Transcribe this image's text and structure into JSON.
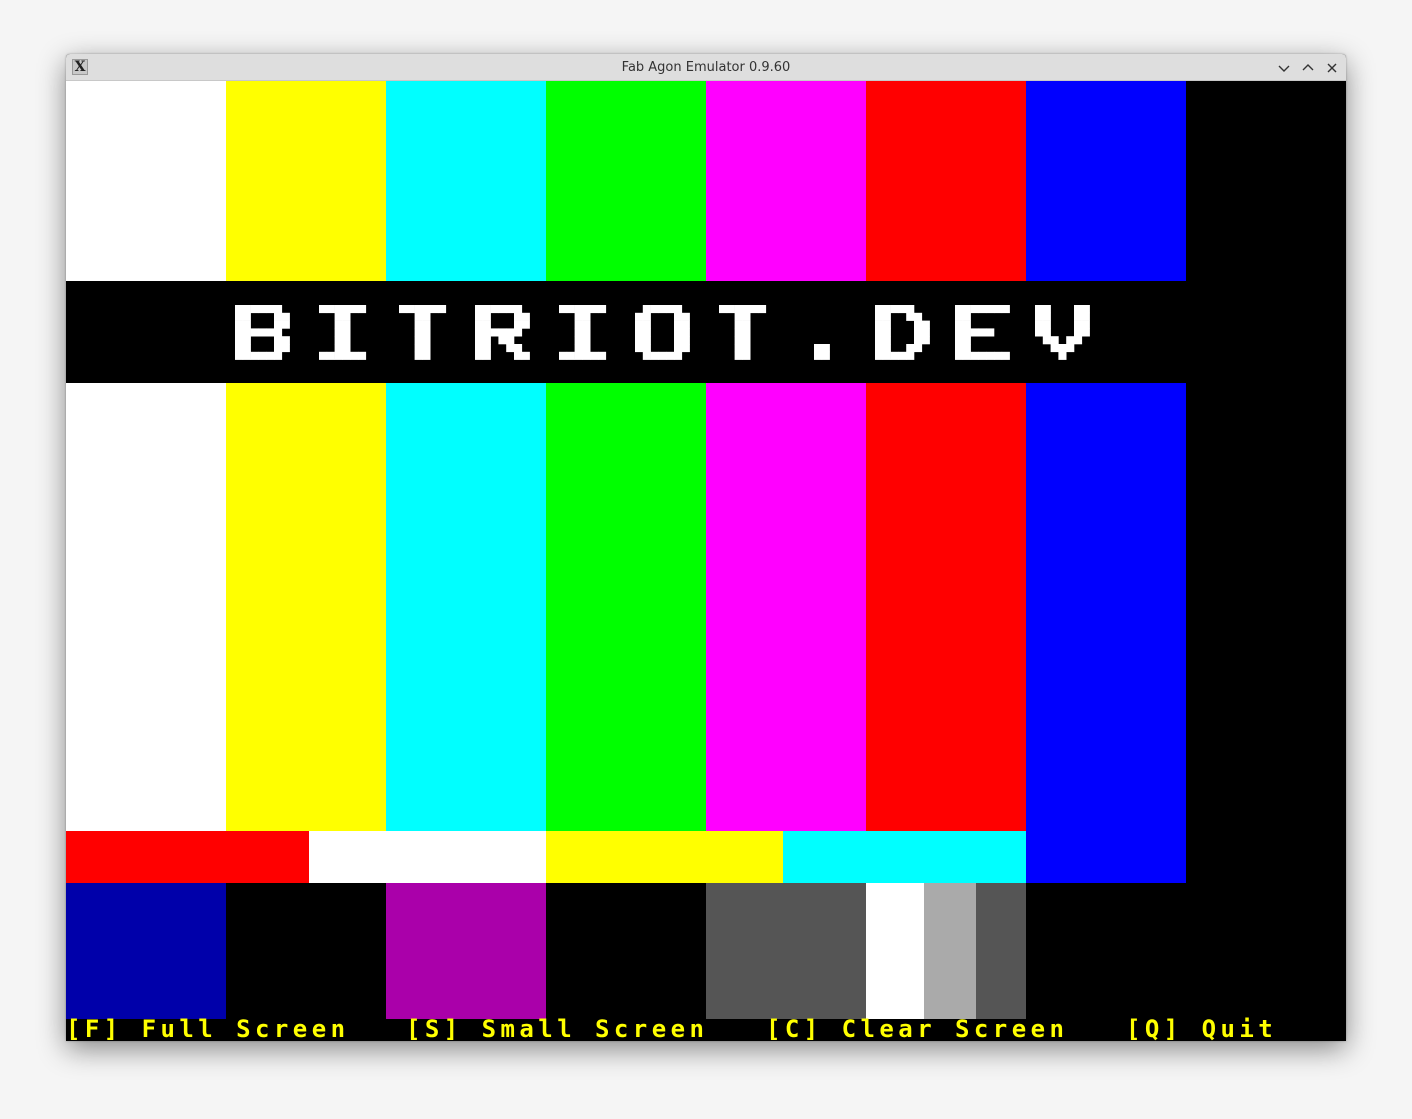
{
  "window": {
    "title": "Fab Agon Emulator 0.9.60",
    "app_icon_glyph": "X",
    "buttons": {
      "minimize_icon": "chevron-down-icon",
      "maximize_icon": "chevron-up-icon",
      "close_icon": "close-icon"
    }
  },
  "screen": {
    "banner_text": "BITRIOT.DEV",
    "colors": {
      "white": "#ffffff",
      "yellow": "#ffff00",
      "cyan": "#00ffff",
      "green": "#00ff00",
      "magenta": "#ff00ff",
      "red": "#ff0000",
      "blue": "#0000ff",
      "dark_blue": "#0000aa",
      "purple": "#aa00aa",
      "dark_gray": "#555555",
      "light_gray": "#aaaaaa",
      "black": "#000000"
    },
    "menu": [
      {
        "label": "[F] Full Screen"
      },
      {
        "label": "[S] Small Screen"
      },
      {
        "label": "[C] Clear Screen"
      },
      {
        "label": "[Q] Quit"
      }
    ]
  }
}
